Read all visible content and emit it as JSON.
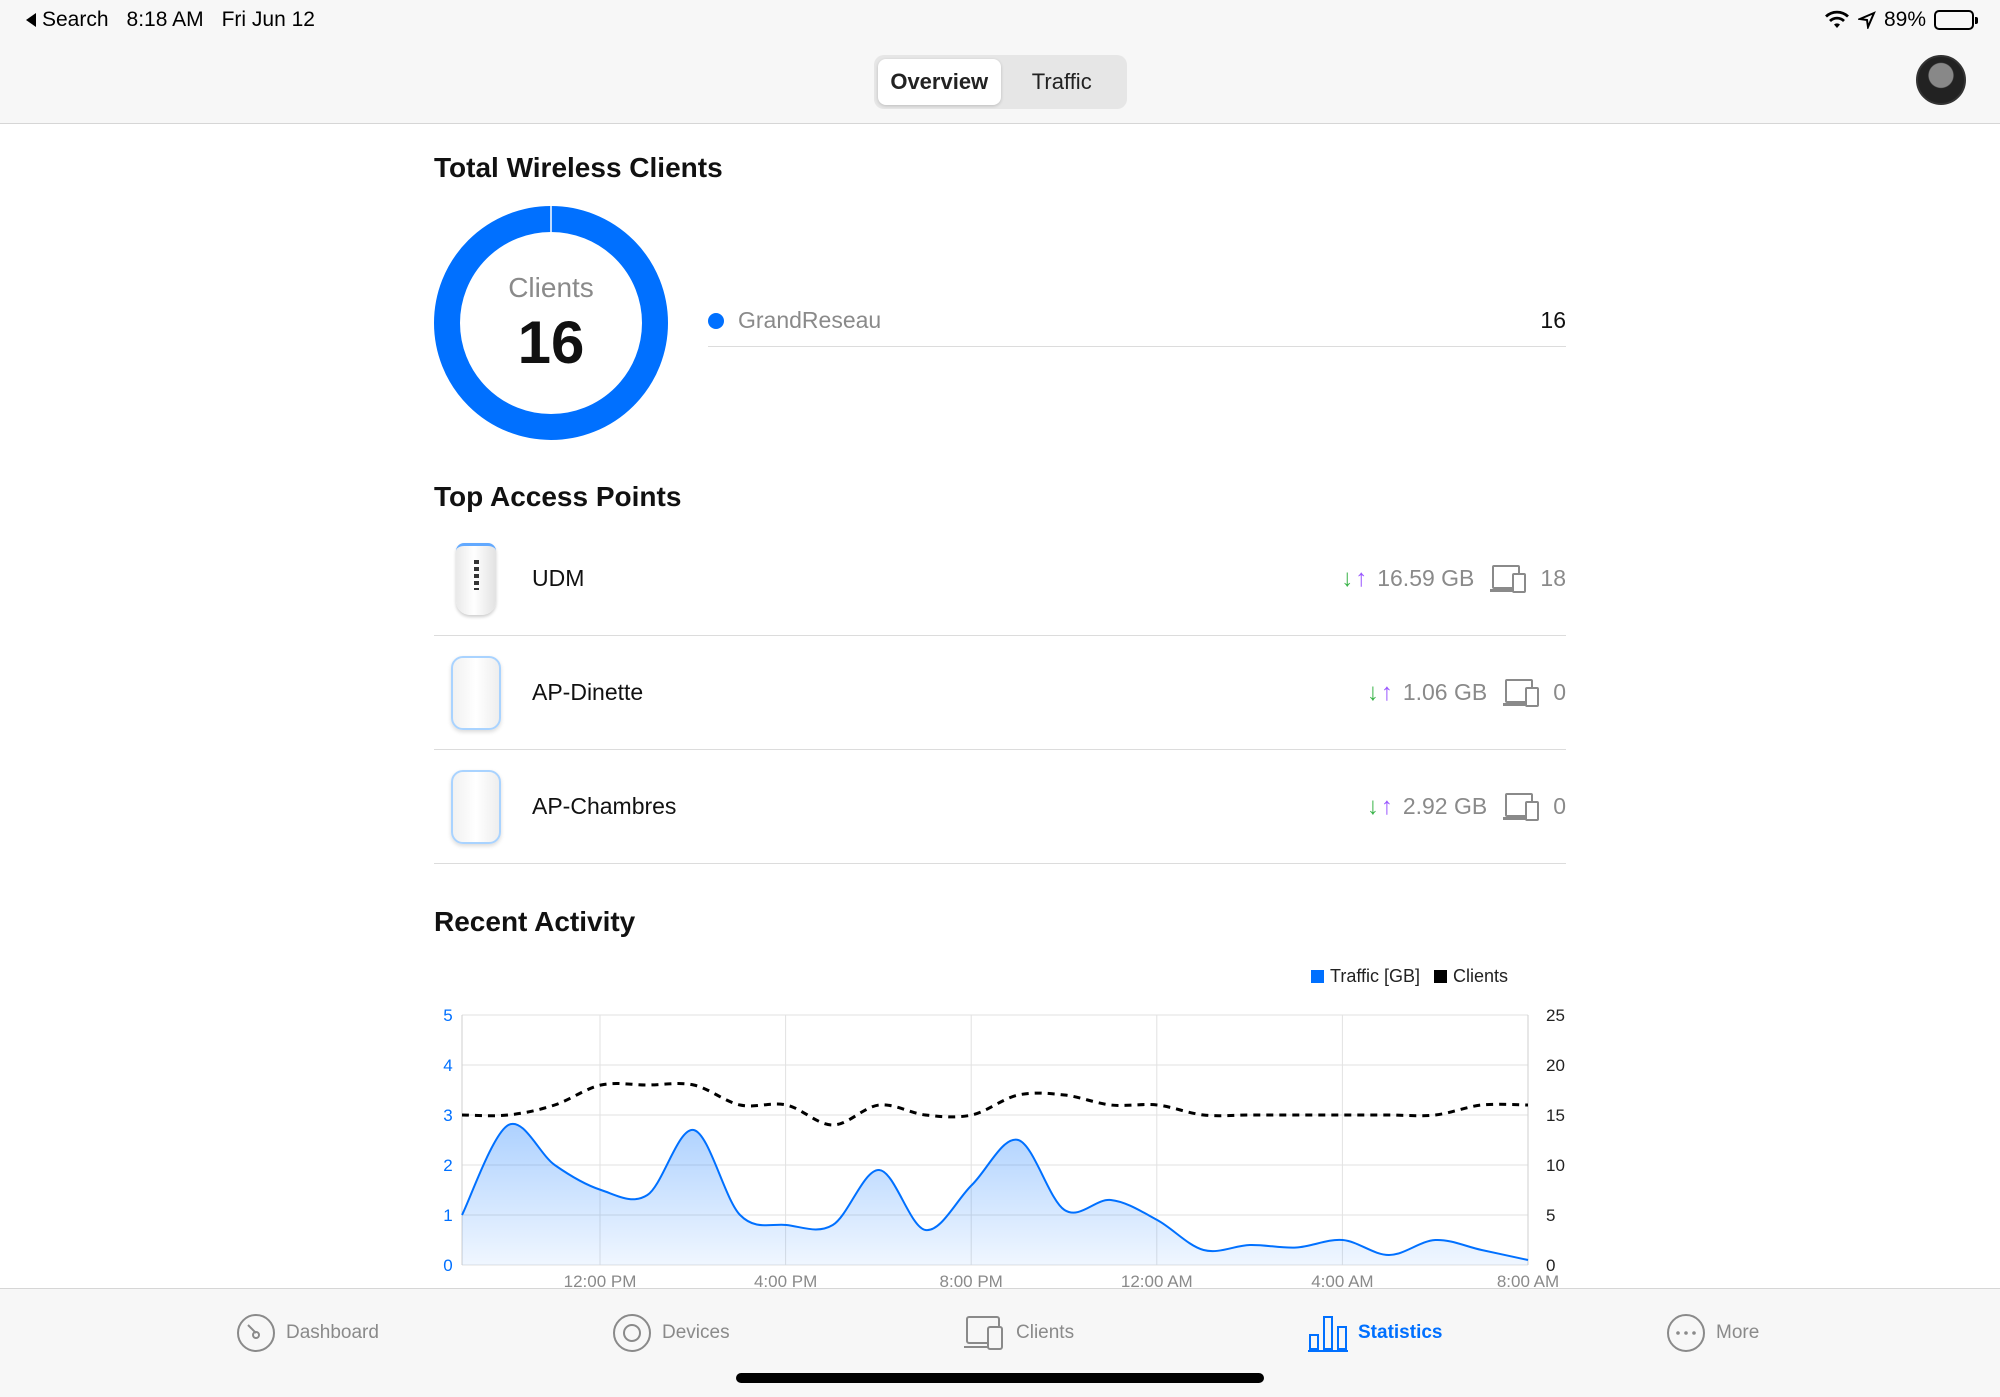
{
  "status": {
    "back_label": "Search",
    "time": "8:18 AM",
    "date": "Fri Jun 12",
    "battery": "89%"
  },
  "header": {
    "tabs": [
      {
        "label": "Overview"
      },
      {
        "label": "Traffic"
      }
    ]
  },
  "wireless": {
    "title": "Total Wireless Clients",
    "donut_label": "Clients",
    "donut_value": "16",
    "accent": "#0070ff",
    "networks": [
      {
        "name": "GrandReseau",
        "count": "16"
      }
    ]
  },
  "access_points": {
    "title": "Top Access Points",
    "items": [
      {
        "name": "UDM",
        "traffic": "16.59 GB",
        "clients": "18"
      },
      {
        "name": "AP-Dinette",
        "traffic": "1.06 GB",
        "clients": "0"
      },
      {
        "name": "AP-Chambres",
        "traffic": "2.92 GB",
        "clients": "0"
      }
    ]
  },
  "activity": {
    "title": "Recent Activity",
    "chart_data": {
      "type": "area",
      "series": [
        {
          "name": "Traffic [GB]",
          "axis": "left",
          "color": "#0070ff",
          "values": [
            1.0,
            2.8,
            2.0,
            1.5,
            1.4,
            2.7,
            1.0,
            0.8,
            0.8,
            1.9,
            0.7,
            1.6,
            2.5,
            1.1,
            1.3,
            0.9,
            0.3,
            0.4,
            0.35,
            0.5,
            0.2,
            0.5,
            0.3,
            0.1
          ]
        },
        {
          "name": "Clients",
          "axis": "right",
          "color": "#000000",
          "style": "dashed",
          "values": [
            15,
            15,
            16,
            18,
            18,
            18,
            16,
            16,
            14,
            16,
            15,
            15,
            17,
            17,
            16,
            16,
            15,
            15,
            15,
            15,
            15,
            15,
            16,
            16
          ]
        }
      ],
      "x_ticks": [
        "12:00 PM",
        "4:00 PM",
        "8:00 PM",
        "12:00 AM",
        "4:00 AM",
        "8:00 AM"
      ],
      "y_left": {
        "ticks": [
          "0",
          "1",
          "2",
          "3",
          "4",
          "5"
        ],
        "range": [
          0,
          5
        ]
      },
      "y_right": {
        "ticks": [
          "0",
          "5",
          "10",
          "15",
          "20",
          "25"
        ],
        "range": [
          0,
          25
        ]
      },
      "grid": true,
      "legend_position": "top-right"
    }
  },
  "tabbar": {
    "items": [
      {
        "label": "Dashboard"
      },
      {
        "label": "Devices"
      },
      {
        "label": "Clients"
      },
      {
        "label": "Statistics"
      },
      {
        "label": "More"
      }
    ]
  }
}
